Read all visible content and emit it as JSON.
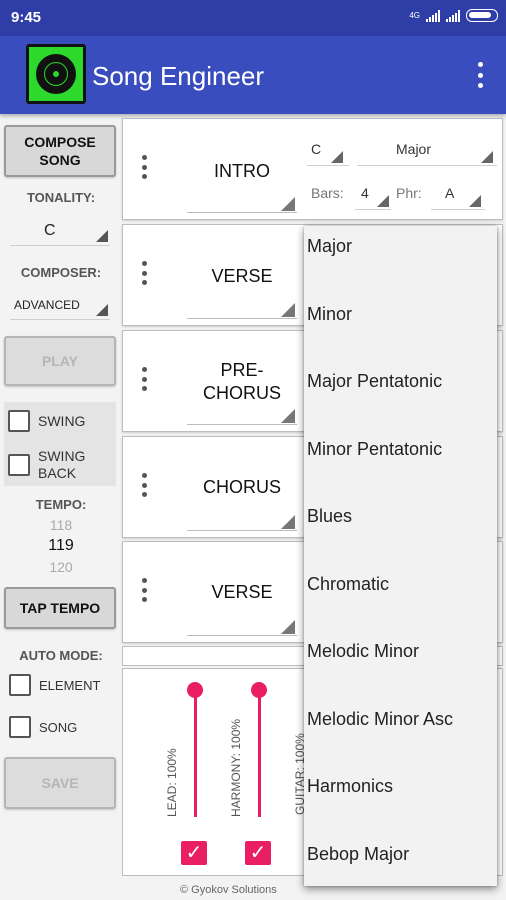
{
  "status_bar": {
    "time": "9:45",
    "network": "4G"
  },
  "app_bar": {
    "title": "Song Engineer",
    "logo_icon": "vinyl-record-icon",
    "menu_icon": "overflow-menu-icon",
    "color": "#3a4dbf"
  },
  "left_panel": {
    "compose_button": "COMPOSE SONG",
    "tonality_label": "TONALITY:",
    "tonality_value": "C",
    "composer_label": "COMPOSER:",
    "composer_value": "ADVANCED",
    "play_button": "PLAY",
    "swing_label": "SWING",
    "swing_back_label": "SWING BACK",
    "tempo_label": "TEMPO:",
    "tempo_prev": "118",
    "tempo_current": "119",
    "tempo_next": "120",
    "tap_tempo_button": "TAP TEMPO",
    "auto_mode_label": "AUTO MODE:",
    "element_label": "ELEMENT",
    "song_label": "SONG",
    "save_button": "SAVE"
  },
  "sections": [
    {
      "name": "INTRO",
      "key": "C",
      "scale": "Major",
      "bars_label": "Bars:",
      "bars": "4",
      "phr_label": "Phr:",
      "phr": "A"
    },
    {
      "name": "VERSE"
    },
    {
      "name": "PRE-CHORUS"
    },
    {
      "name": "CHORUS"
    },
    {
      "name": "VERSE"
    }
  ],
  "mixer": {
    "lead_label": "LEAD: 100%",
    "harmony_label": "HARMONY: 100%",
    "guitar_label": "GUITAR: 100%",
    "lead_level": 1.0,
    "harmony_level": 1.0,
    "accent": "#e91e63"
  },
  "scale_dropdown": {
    "options": [
      "Major",
      "Minor",
      "Major Pentatonic",
      "Minor Pentatonic",
      "Blues",
      "Chromatic",
      "Melodic Minor",
      "Melodic Minor Asc",
      "Harmonics",
      "Bebop Major"
    ]
  },
  "footer": "© Gyokov Solutions"
}
